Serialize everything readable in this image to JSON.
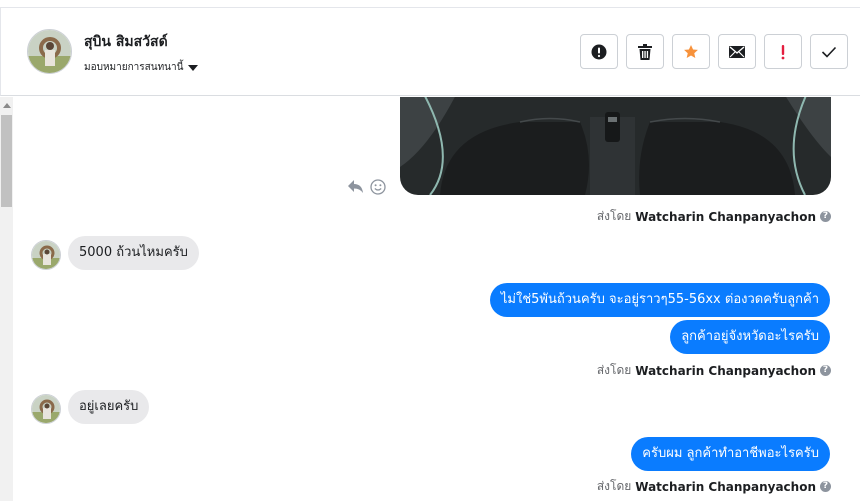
{
  "header": {
    "contact_name": "สุบิน สิมสวัสด์",
    "assign_label": "มอบหมายการสนทนานี้"
  },
  "toolbar": {
    "icons": [
      "alert-circle-icon",
      "trash-icon",
      "star-icon",
      "envelope-icon",
      "exclamation-icon",
      "check-icon"
    ],
    "star_color": "#f7923b",
    "exclamation_color": "#e41e3f"
  },
  "thread": {
    "sent_by_prefix": "ส่งโดย",
    "agent_name": "Watcharin Chanpanyachon",
    "messages": {
      "incoming_1": "5000 ถ้วนไหมครับ",
      "outgoing_1": "ไม่ใช่5พันถ้วนครับ จะอยู่ราวๆ55-56xx ต่องวดครับลูกค้า",
      "outgoing_2": "ลูกค้าอยู่จังหวัดอะไรครับ",
      "incoming_2": "อยู่เลยครับ",
      "outgoing_3": "ครับผม ลูกค้าทำอาชีพอะไรครับ"
    }
  },
  "colors": {
    "outgoing_bubble": "#0a7cff",
    "incoming_bubble": "#e9e9eb"
  }
}
